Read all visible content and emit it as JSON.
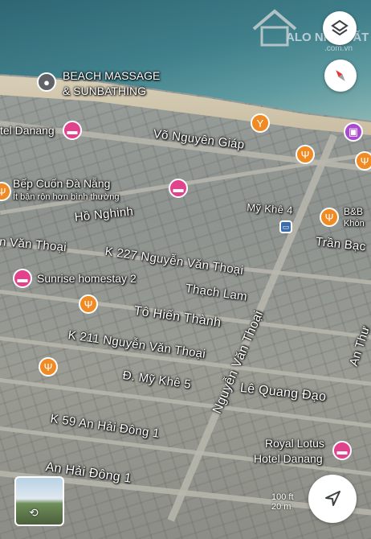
{
  "map": {
    "streets": [
      {
        "id": "vo-nguyen-giap",
        "text": "Võ Nguyên Giáp"
      },
      {
        "id": "ho-nghinh",
        "text": "Hồ Nghinh"
      },
      {
        "id": "nguyen-van-thoai-left",
        "text": "n Văn Thoại"
      },
      {
        "id": "k227",
        "text": "K 227 Nguyễn Văn Thoại"
      },
      {
        "id": "thach-lam",
        "text": "Thạch Lam"
      },
      {
        "id": "to-hien-thanh",
        "text": "Tô Hiến Thành"
      },
      {
        "id": "k211",
        "text": "K 211 Nguyễn Văn Thoại"
      },
      {
        "id": "my-khe-5",
        "text": "Đ. Mỹ Khê 5"
      },
      {
        "id": "nguyen-van-thoai",
        "text": "Nguyễn Văn Thoại"
      },
      {
        "id": "le-quang-dao",
        "text": "Lê Quang Đạo"
      },
      {
        "id": "k59-an-hai-dong-1",
        "text": "K 59 An Hải Đông 1"
      },
      {
        "id": "an-hai-dong-1",
        "text": "An Hải Đông 1"
      },
      {
        "id": "my-khe-4",
        "text": "Mỹ Khê 4"
      },
      {
        "id": "tran-bach",
        "text": "Trần Bạc"
      },
      {
        "id": "an-thuong",
        "text": "An Thư"
      }
    ],
    "places": {
      "beach_massage_line1": "BEACH MASSAGE",
      "beach_massage_line2": "& SUNBATHING",
      "hotel_danang": "tel Danang",
      "bep_cuon_name": "Bếp Cuốn Đà Nẵng",
      "bep_cuon_note": "Ít bận rộn hơn bình thường",
      "sunrise": "Sunrise homestay 2",
      "bnb_line1": "B&B",
      "bnb_line2": "Khôn",
      "royal_lotus_line1": "Royal Lotus",
      "royal_lotus_line2": "Hotel Danang"
    },
    "watermark_line1": "ALO NHÀ ĐẤT",
    "watermark_line2": ".com.vn",
    "scale_line1": "100 ft",
    "scale_line2": "20 m",
    "icons": {
      "layers": "layers-icon",
      "compass": "compass-icon",
      "navigate": "navigation-arrow-icon",
      "street_view": "street-view-thumbnail"
    }
  }
}
